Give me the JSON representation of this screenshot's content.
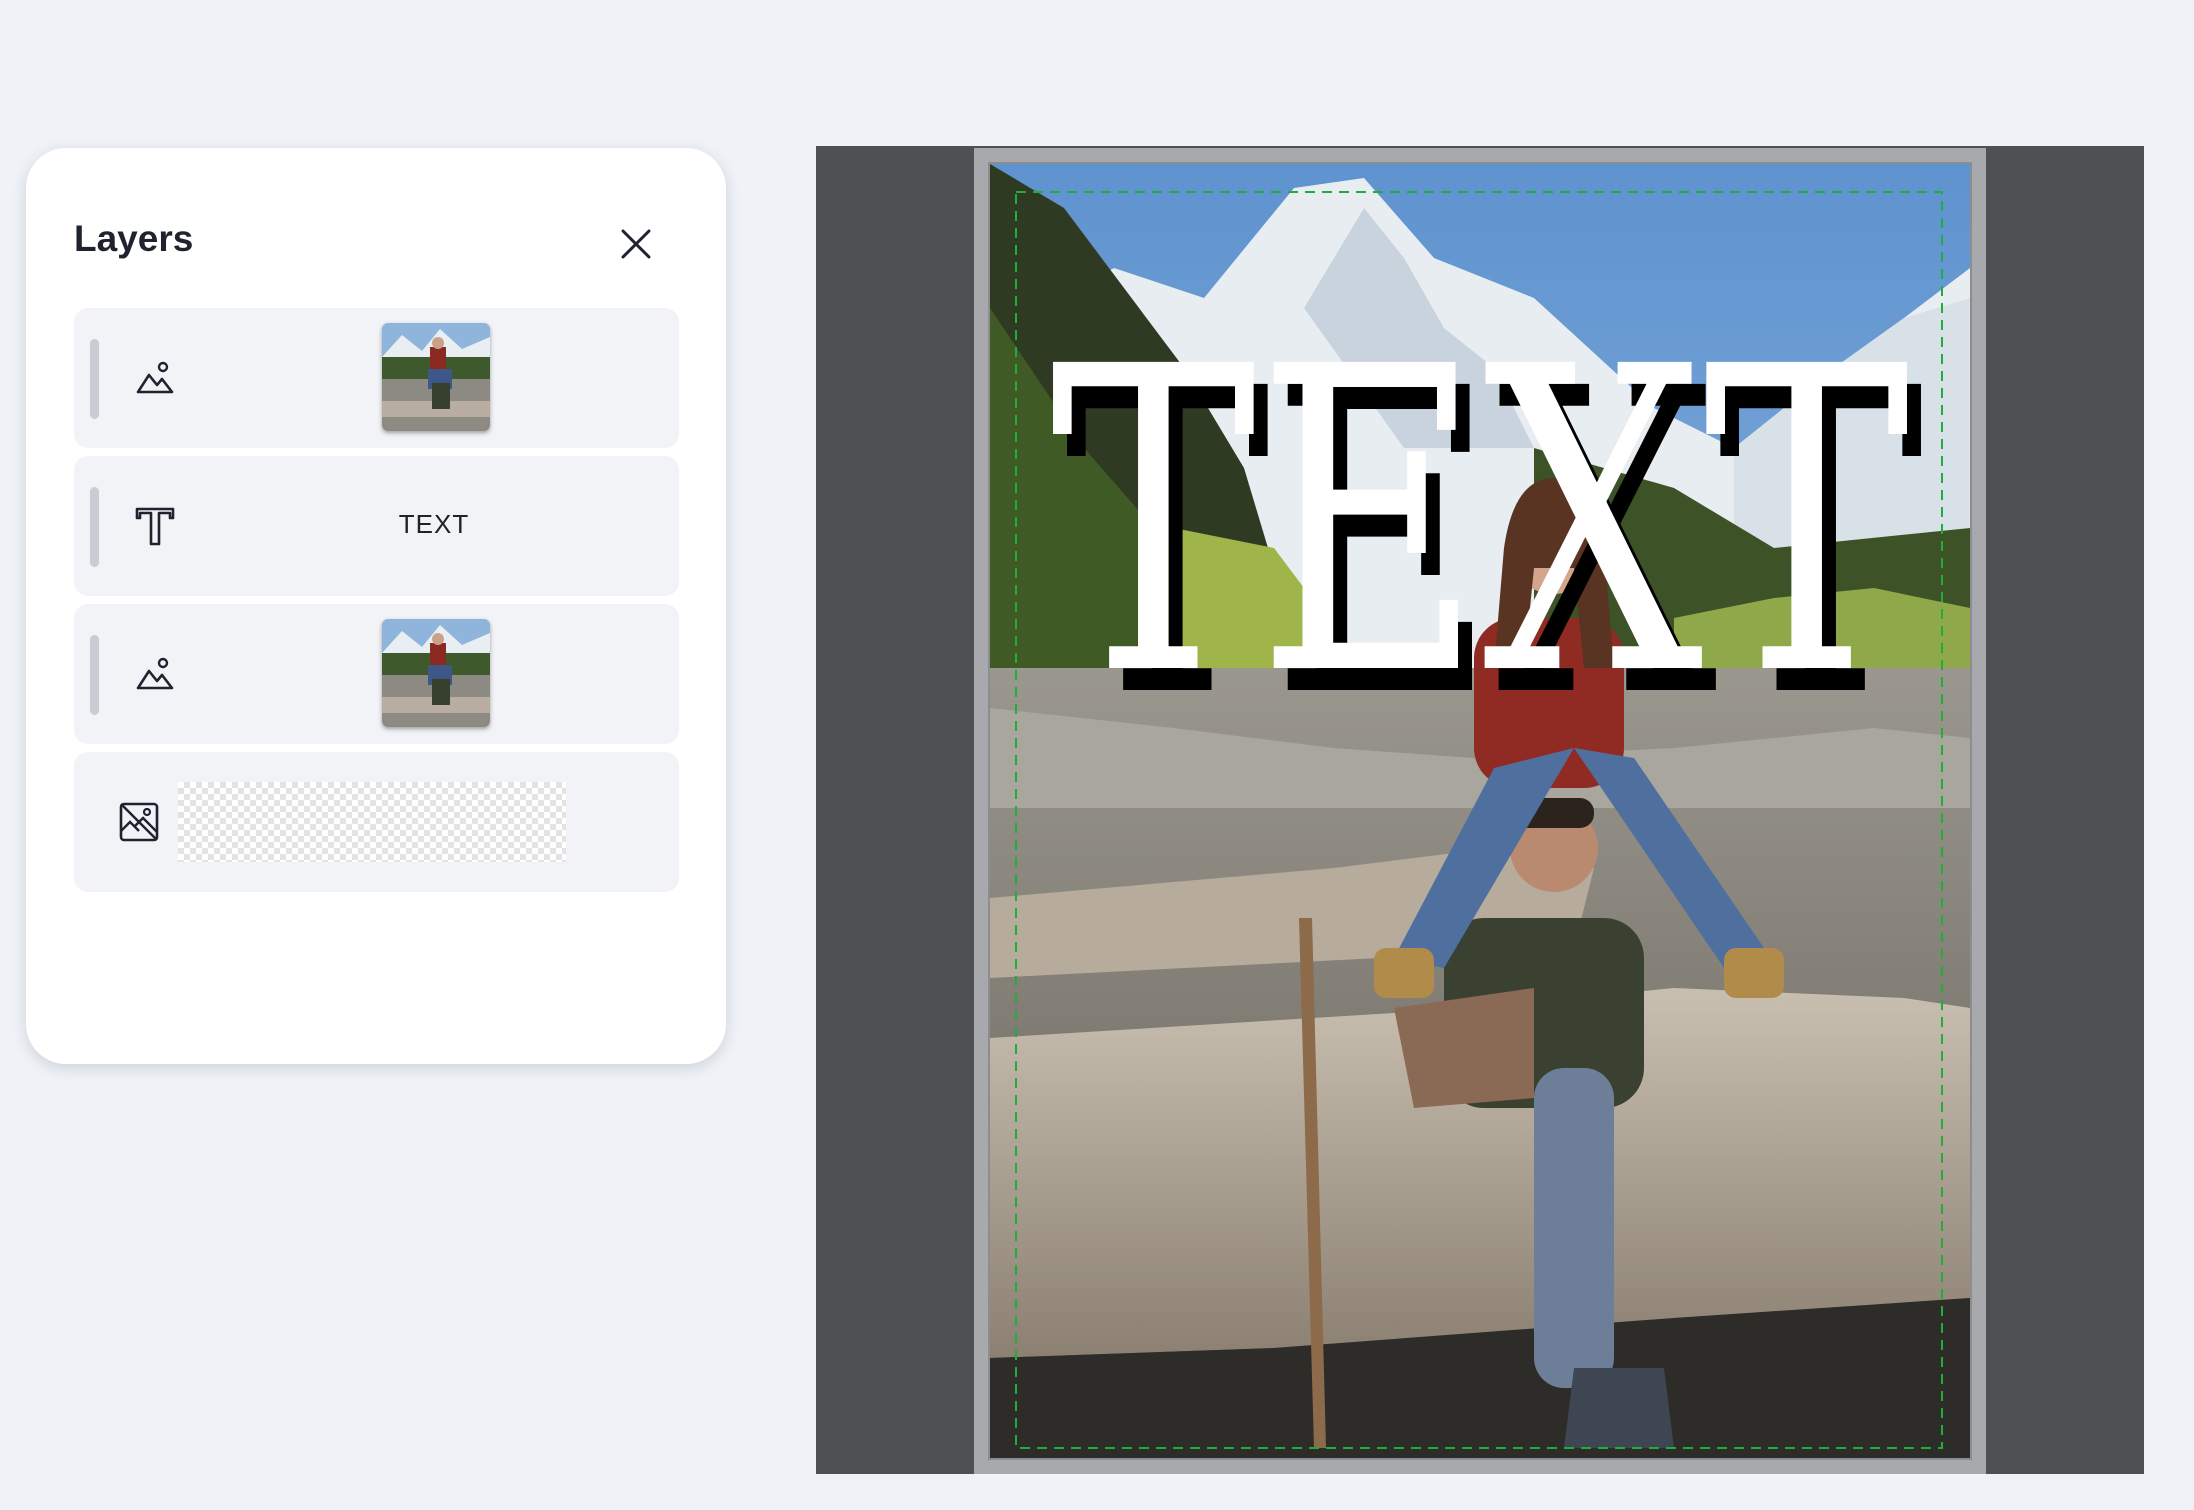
{
  "panel": {
    "title": "Layers",
    "close_icon": "close-icon"
  },
  "layers": [
    {
      "type": "image",
      "icon": "image-layer-icon"
    },
    {
      "type": "text",
      "icon": "text-layer-icon",
      "label": "TEXT"
    },
    {
      "type": "image",
      "icon": "image-layer-icon"
    },
    {
      "type": "background",
      "icon": "background-layer-icon"
    }
  ],
  "canvas": {
    "headline_text": "TEXT",
    "colors": {
      "workspace": "#4f5054",
      "safe_area_guide": "#1fae3a",
      "text_fill": "#ffffff",
      "text_shadow": "#000000"
    }
  }
}
